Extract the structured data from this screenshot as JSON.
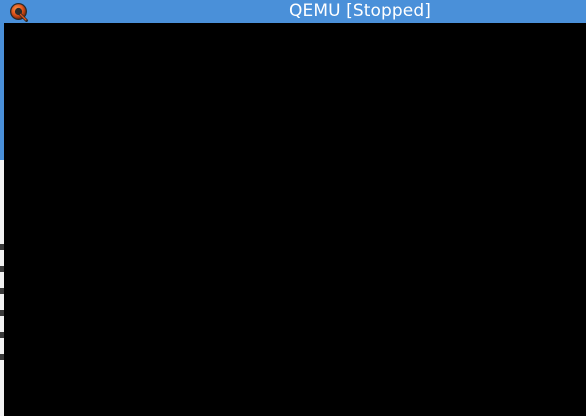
{
  "window": {
    "title": "QEMU [Stopped]",
    "icon": "qemu-logo-icon"
  },
  "colors": {
    "titlebar": "#4a90d9",
    "display": "#000000",
    "title_text": "#ffffff"
  }
}
